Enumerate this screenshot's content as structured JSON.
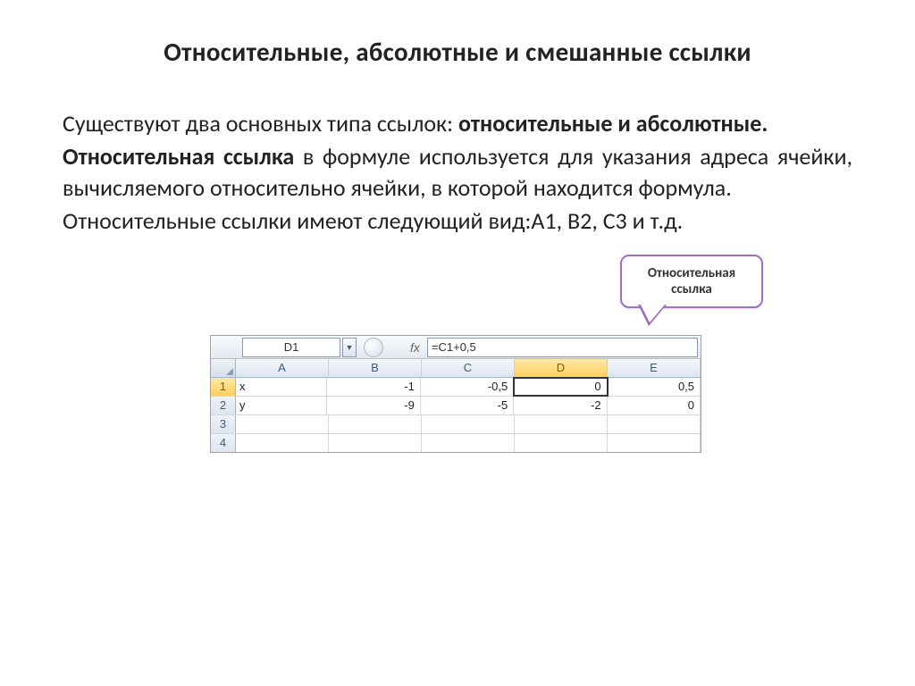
{
  "title": "Относительные, абсолютные и   смешанные ссылки",
  "para1_a": "Существуют два основных типа ссылок: ",
  "para1_b": "относительные и абсолютные.",
  "para2_a": "Относительная ссылка",
  "para2_b": " в формуле используется для указания адреса ячейки, вычисляемого относительно ячейки, в которой находится формула.",
  "para3": "Относительные ссылки имеют следующий вид:A1, B2, C3 и т.д.",
  "callout": {
    "line1": "Относительная",
    "line2": "ссылка"
  },
  "excel": {
    "name_box": "D1",
    "fx": "fx",
    "formula": "=C1+0,5",
    "cols": [
      "A",
      "B",
      "C",
      "D",
      "E"
    ],
    "active_col_index": 3,
    "rows": [
      {
        "n": "1",
        "cells": [
          "x",
          "-1",
          "-0,5",
          "0",
          "0,5"
        ],
        "active": true,
        "selected_col": 3,
        "left0": true
      },
      {
        "n": "2",
        "cells": [
          "y",
          "-9",
          "-5",
          "-2",
          "0"
        ],
        "left0": true
      },
      {
        "n": "3",
        "cells": [
          "",
          "",
          "",
          "",
          ""
        ]
      },
      {
        "n": "4",
        "cells": [
          "",
          "",
          "",
          "",
          ""
        ]
      }
    ]
  }
}
